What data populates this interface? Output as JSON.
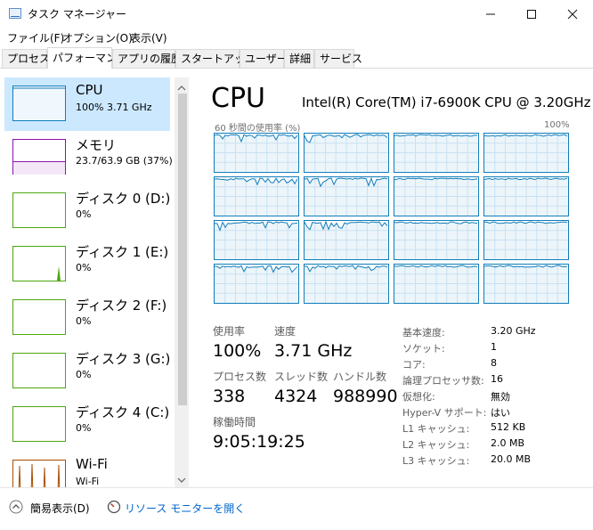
{
  "window": {
    "title": "タスク マネージャー"
  },
  "menu": [
    "ファイル(F)",
    "オプション(O)",
    "表示(V)"
  ],
  "tabs": [
    "プロセス",
    "パフォーマンス",
    "アプリの履歴",
    "スタートアップ",
    "ユーザー",
    "詳細",
    "サービス"
  ],
  "sidebar": [
    {
      "name": "CPU",
      "sub": "100% 3.71 GHz"
    },
    {
      "name": "メモリ",
      "sub": "23.7/63.9 GB (37%)"
    },
    {
      "name": "ディスク 0 (D:)",
      "sub": "0%"
    },
    {
      "name": "ディスク 1 (E:)",
      "sub": "0%"
    },
    {
      "name": "ディスク 2 (F:)",
      "sub": "0%"
    },
    {
      "name": "ディスク 3 (G:)",
      "sub": "0%"
    },
    {
      "name": "ディスク 4 (C:)",
      "sub": "0%"
    },
    {
      "name": "Wi-Fi",
      "sub": "Wi-Fi"
    }
  ],
  "cpu": {
    "title": "CPU",
    "model": "Intel(R) Core(TM) i7-6900K CPU @ 3.20GHz",
    "graph_label": "60 秒間の使用率 (%)",
    "graph_max": "100%",
    "stats": {
      "usage_label": "使用率",
      "usage": "100%",
      "speed_label": "速度",
      "speed": "3.71 GHz",
      "proc_label": "プロセス数",
      "proc": "338",
      "threads_label": "スレッド数",
      "threads": "4324",
      "handles_label": "ハンドル数",
      "handles": "988990",
      "uptime_label": "稼働時間",
      "uptime": "9:05:19:25"
    },
    "specs": [
      {
        "k": "基本速度:",
        "v": "3.20 GHz"
      },
      {
        "k": "ソケット:",
        "v": "1"
      },
      {
        "k": "コア:",
        "v": "8"
      },
      {
        "k": "論理プロセッサ数:",
        "v": "16"
      },
      {
        "k": "仮想化:",
        "v": "無効"
      },
      {
        "k": "Hyper-V サポート:",
        "v": "はい"
      },
      {
        "k": "L1 キャッシュ:",
        "v": "512 KB"
      },
      {
        "k": "L2 キャッシュ:",
        "v": "2.0 MB"
      },
      {
        "k": "L3 キャッシュ:",
        "v": "20.0 MB"
      }
    ]
  },
  "footer": {
    "fewer_details": "簡易表示(D)",
    "resource_monitor": "リソース モニターを開く"
  },
  "colors": {
    "cpu": "#117dbb",
    "memory": "#8b12ae",
    "disk": "#4da60c",
    "network": "#a74f01",
    "selected": "#cce8ff"
  }
}
